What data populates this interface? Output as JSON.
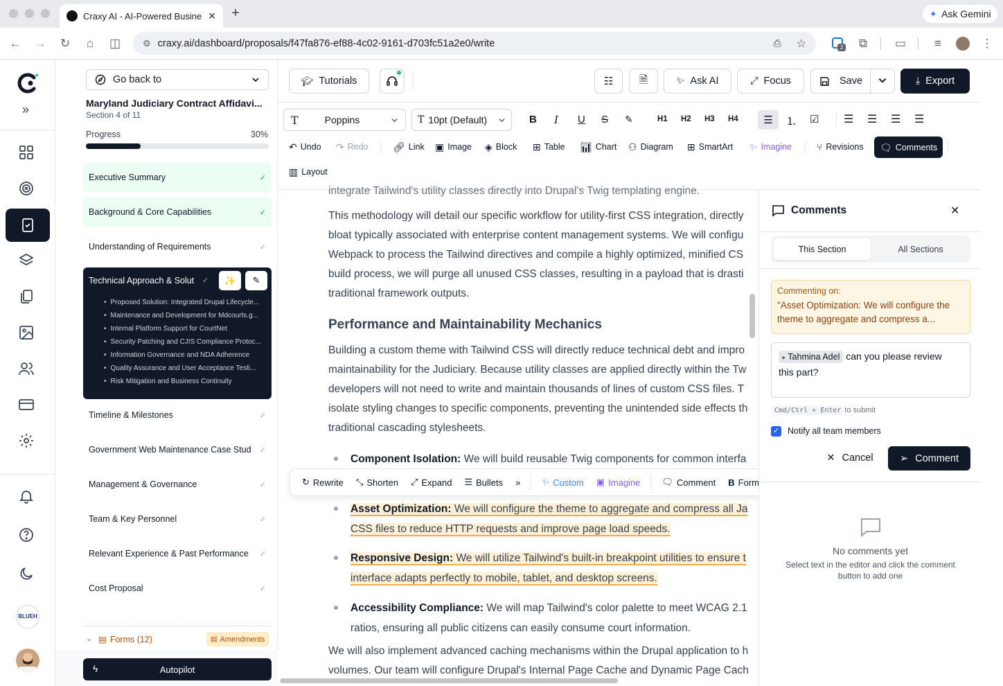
{
  "browser": {
    "tab_title": "Craxy AI - AI-Powered Busine",
    "url": "craxy.ai/dashboard/proposals/f47fa876-ef88-4c02-9161-d703fc51a2e0/write",
    "gemini_label": "Ask Gemini",
    "ext_badge": "2"
  },
  "sidebar": {
    "go_back": "Go back to",
    "doc_title": "Maryland Judiciary Contract Affidavi...",
    "section_count": "Section 4 of 11",
    "progress_label": "Progress",
    "progress_text": "30%",
    "progress_value": 0.3,
    "sections": [
      {
        "label": "Executive Summary",
        "status": "done"
      },
      {
        "label": "Background & Core Capabilities",
        "status": "done"
      },
      {
        "label": "Understanding of Requirements",
        "status": "todo"
      },
      {
        "label": "Technical Approach & Solut",
        "status": "active"
      },
      {
        "label": "Timeline & Milestones",
        "status": "todo"
      },
      {
        "label": "Government Web Maintenance Case Stud",
        "status": "todo"
      },
      {
        "label": "Management & Governance",
        "status": "todo"
      },
      {
        "label": "Team & Key Personnel",
        "status": "todo"
      },
      {
        "label": "Relevant Experience & Past Performance",
        "status": "todo"
      },
      {
        "label": "Cost Proposal",
        "status": "todo"
      }
    ],
    "active_subsections": [
      "Proposed Solution: Integrated Drupal Lifecycle...",
      "Maintenance and Development for Mdcourts.g...",
      "Internal Platform Support for CourtNet",
      "Security Patching and CJIS Compliance Protoc...",
      "Information Governance and NDA Adherence",
      "Quality Assurance and User Acceptance Testi...",
      "Risk Mitigation and Business Continuity"
    ],
    "forms_label": "Forms (12)",
    "amendments_label": "Amendments",
    "autopilot_label": "Autopilot"
  },
  "rail": {
    "avatar_text": "BLUEH"
  },
  "topbar": {
    "tutorials": "Tutorials",
    "ask_ai": "Ask AI",
    "focus": "Focus",
    "save": "Save",
    "export": "Export"
  },
  "format": {
    "font": "Poppins",
    "size": "10pt (Default)",
    "headings": [
      "H1",
      "H2",
      "H3",
      "H4"
    ],
    "undo": "Undo",
    "redo": "Redo",
    "link": "Link",
    "image": "Image",
    "block": "Block",
    "table": "Table",
    "chart": "Chart",
    "diagram": "Diagram",
    "smartart": "SmartArt",
    "imagine": "Imagine",
    "revisions": "Revisions",
    "comments": "Comments",
    "layout": "Layout"
  },
  "editor": {
    "line0": "integrate Tailwind's utility classes directly into Drupal's Twig templating engine.",
    "para1": [
      "This methodology will detail our specific workflow for utility-first CSS integration, directly",
      "bloat typically associated with enterprise content management systems. We will configu",
      "Webpack to process the Tailwind directives and compile a highly optimized, minified CS",
      "build process, we will purge all unused CSS classes, resulting in a payload that is drasti",
      "traditional framework outputs."
    ],
    "heading": "Performance and Maintainability Mechanics",
    "para2": [
      "Building a custom theme with Tailwind CSS will directly reduce technical debt and impro",
      "maintainability for the Judiciary. Because utility classes are applied directly within the Tw",
      "developers will not need to write and maintain thousands of lines of custom CSS files. T",
      "isolate styling changes to specific components, preventing the unintended side effects th",
      "traditional cascading stylesheets."
    ],
    "b1_bold": "Component Isolation:",
    "b1_text": " We will build reusable Twig components for common interfa",
    "b2_bold": "Asset Optimization:",
    "b2_text1": " We will configure the theme to aggregate and compress all Ja",
    "b2_text2": "CSS files to reduce HTTP requests and improve page load speeds.",
    "b3_bold": "Responsive Design:",
    "b3_text1": " We will utilize Tailwind's built-in breakpoint utilities to ensure t",
    "b3_text2": "interface adapts perfectly to mobile, tablet, and desktop screens.",
    "b4_bold": "Accessibility Compliance:",
    "b4_text1": " We will map Tailwind's color palette to meet WCAG 2.1",
    "b4_text2": "ratios, ensuring all public citizens can easily consume court information.",
    "para3": [
      "We will also implement advanced caching mechanisms within the Drupal application to h",
      "volumes. Our team will configure Drupal's Internal Page Cache and Dynamic Page Cach"
    ]
  },
  "floatbar": {
    "rewrite": "Rewrite",
    "shorten": "Shorten",
    "expand": "Expand",
    "bullets": "Bullets",
    "more": "»",
    "custom": "Custom",
    "imagine": "Imagine",
    "comment": "Comment",
    "format": "Format"
  },
  "comments": {
    "title": "Comments",
    "tab_this": "This Section",
    "tab_all": "All Sections",
    "commenting_on": "Commenting on:",
    "quote": "\"Asset Optimization: We will configure the theme to aggregate and compress a...",
    "mention": "Tahmina Adel",
    "draft_rest": "can you please review",
    "draft_rest2": "this part?",
    "hint_key": "Cmd/Ctrl + Enter",
    "hint_text": "to submit",
    "notify": "Notify all team members",
    "notify_checked": true,
    "cancel": "Cancel",
    "submit": "Comment",
    "empty_title": "No comments yet",
    "empty_text1": "Select text in the editor and click the comment",
    "empty_text2": "button to add one"
  },
  "colors": {
    "accent_dark": "#111827",
    "done_bg": "#ecfdf3",
    "highlight": "#fdf0d5",
    "purple": "#8b5cf6",
    "badge_green": "#22c55e"
  }
}
